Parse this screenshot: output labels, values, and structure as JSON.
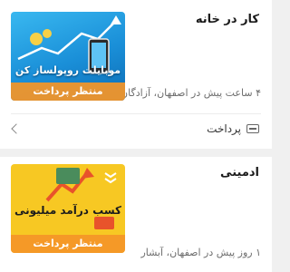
{
  "listings": [
    {
      "title": "کار در خانه",
      "meta": "۴ ساعت پیش در اصفهان، آزادگان",
      "thumbnail_text": "موبایلت روپولساز کن",
      "status_badge": "منتظر پرداخت",
      "payment_label": "پرداخت",
      "payment_icon": "card-icon",
      "chevron_icon": "chevron-left-icon"
    },
    {
      "title": "ادمینی",
      "meta": "۱ روز پیش در اصفهان، آبشار",
      "thumbnail_text": "کسب درآمد میلیونی",
      "status_badge": "منتظر پرداخت"
    }
  ],
  "colors": {
    "badge": "#f49628",
    "thumb1": "#1a8fd8",
    "thumb2": "#f7c823",
    "background": "#f0f0f0"
  }
}
